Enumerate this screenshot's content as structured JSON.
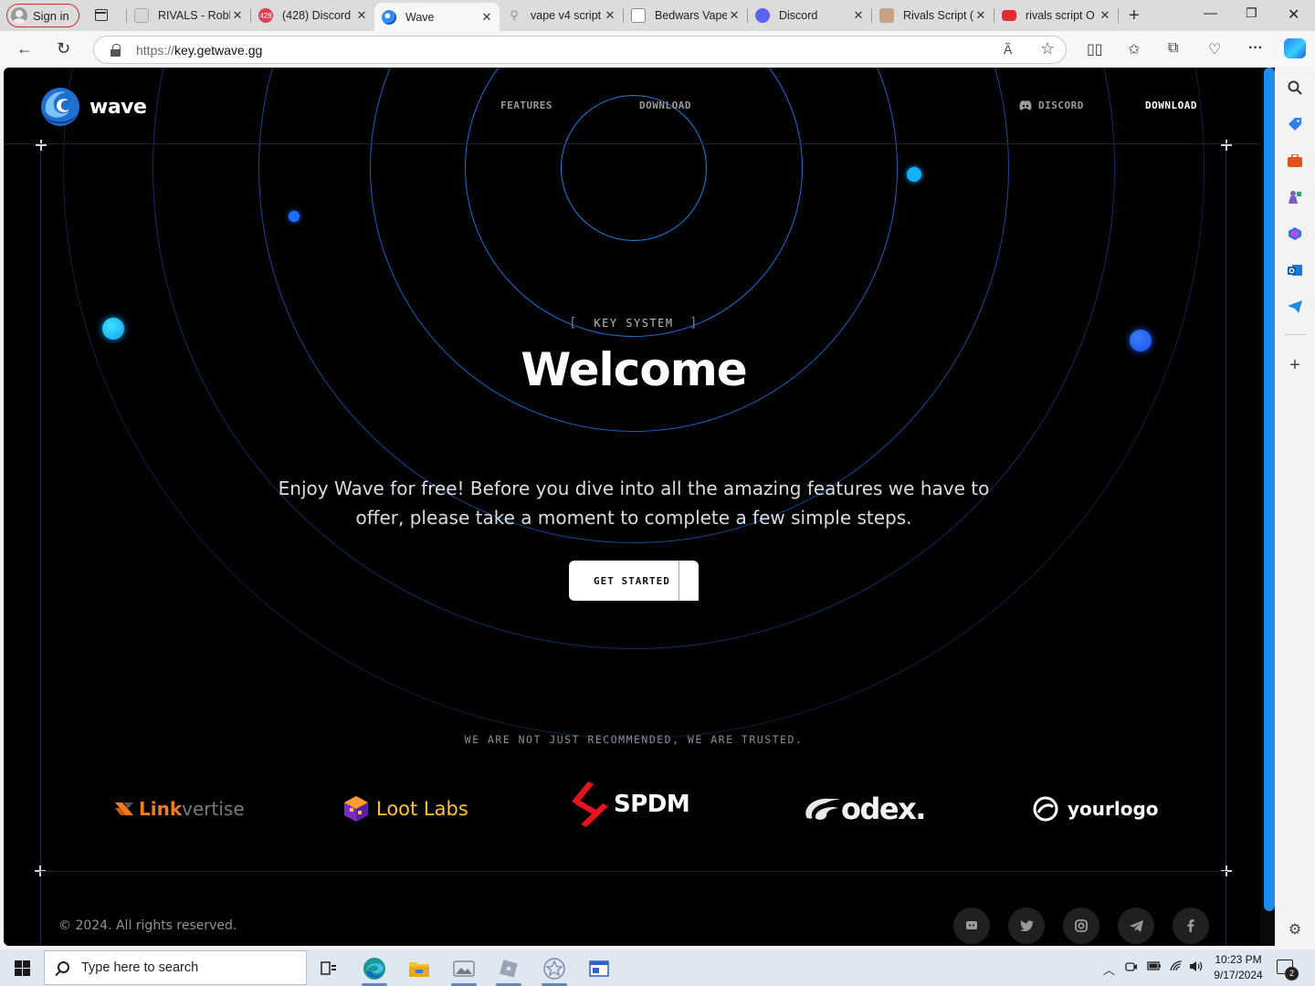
{
  "browser": {
    "profile_label": "Sign in",
    "tabs": [
      {
        "title": "RIVALS - Robl",
        "favicon": "roblox-icon",
        "color": "#9aa3ad"
      },
      {
        "title": "(428) Discord",
        "favicon": "discord-badge-icon",
        "color": "#e23d52",
        "badge": "428"
      },
      {
        "title": "Wave",
        "favicon": "wave-icon",
        "color": "#2d8cff",
        "active": true
      },
      {
        "title": "vape v4 script",
        "favicon": "search-icon",
        "color": "#8a94a6"
      },
      {
        "title": "Bedwars Vape",
        "favicon": "page-icon",
        "color": "#7a7a7a"
      },
      {
        "title": "Discord",
        "favicon": "discord-icon",
        "color": "#5865f2"
      },
      {
        "title": "Rivals Script (",
        "favicon": "script-icon",
        "color": "#b98a6a"
      },
      {
        "title": "rivals script O",
        "favicon": "youtube-icon",
        "color": "#e02d2d"
      }
    ],
    "url_protocol": "https://",
    "url_host": "key.getwave.gg"
  },
  "site": {
    "brand": "wave",
    "nav": {
      "features": "FEATURES",
      "download": "DOWNLOAD",
      "discord": "DISCORD",
      "download_cta": "DOWNLOAD"
    },
    "hero": {
      "kicker": "KEY SYSTEM",
      "title": "Welcome",
      "subtitle": "Enjoy Wave for free! Before you dive into all the amazing features we have to offer, please take a moment to complete a few simple steps.",
      "cta": "GET STARTED"
    },
    "trusted_label": "WE ARE NOT JUST RECOMMENDED, WE ARE TRUSTED.",
    "partners": {
      "linkvertise_a": "Link",
      "linkvertise_b": "vertise",
      "lootlabs": "Loot Labs",
      "spdm": "SPDM",
      "odex": "odex.",
      "yourlogo": "yourlogo"
    },
    "footer": {
      "copyright": "© 2024. All rights reserved.",
      "socials": [
        "discord-icon",
        "twitter-icon",
        "instagram-icon",
        "telegram-icon",
        "facebook-icon"
      ]
    },
    "colors": {
      "accent": "#1a8fff",
      "background": "#000000"
    }
  },
  "taskbar": {
    "search_placeholder": "Type here to search",
    "time": "10:23 PM",
    "date": "9/17/2024",
    "notification_count": "2"
  }
}
